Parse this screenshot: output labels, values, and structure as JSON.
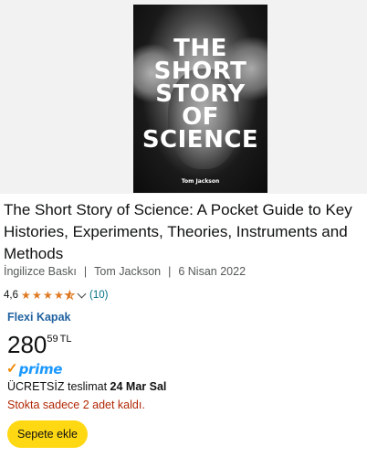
{
  "product": {
    "cover": {
      "title_lines": [
        "THE",
        "SHORT",
        "STORY",
        "OF",
        "SCIENCE"
      ],
      "author": "Tom Jackson"
    },
    "title": "The Short Story of Science: A Pocket Guide to Key Histories, Experiments, Theories, Instruments and Methods",
    "meta": {
      "edition": "İngilizce Baskı",
      "separator": "|",
      "author": "Tom Jackson",
      "date": "6 Nisan 2022"
    },
    "rating": {
      "value_text": "4,6",
      "value": 4.6,
      "stars_max": 5,
      "count_text": "(10)"
    },
    "format": "Flexi Kapak",
    "price": {
      "whole": "280",
      "fraction": "59",
      "currency": "TL"
    },
    "prime": {
      "check": "✓",
      "label": "prime"
    },
    "delivery": {
      "prefix": "ÜCRETSİZ teslimat",
      "date": "24 Mar Sal"
    },
    "stock": "Stokta sadece 2 adet kaldı.",
    "cart_button": "Sepete ekle"
  },
  "colors": {
    "star": "#de7921",
    "link": "#007185",
    "format": "#2162a1",
    "prime_blue": "#1a98ff",
    "prime_check": "#f08804",
    "stock_red": "#b12704",
    "button_yellow": "#ffd814"
  }
}
